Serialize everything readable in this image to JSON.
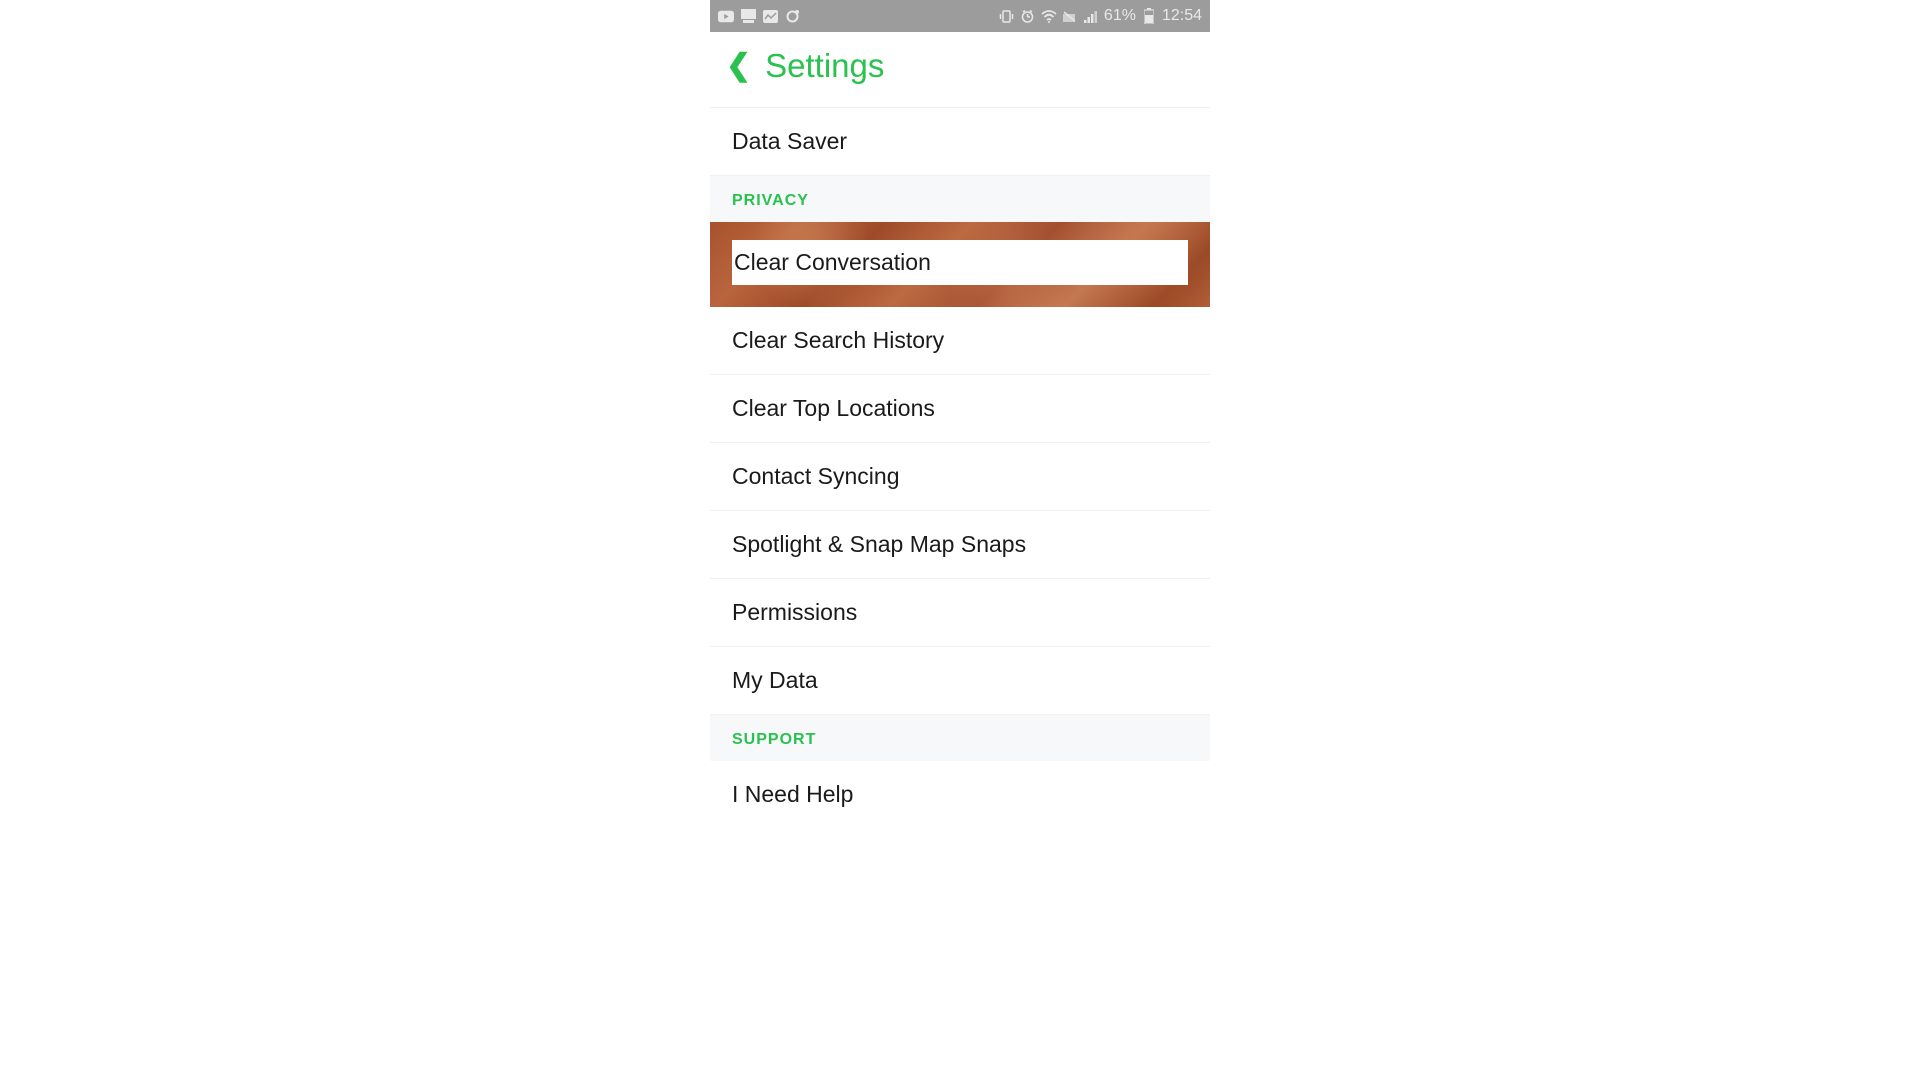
{
  "statusBar": {
    "battery": "61%",
    "time": "12:54"
  },
  "header": {
    "title": "Settings"
  },
  "items": {
    "dataSaver": "Data Saver",
    "clearConversation": "Clear Conversation",
    "clearSearchHistory": "Clear Search History",
    "clearTopLocations": "Clear Top Locations",
    "contactSyncing": "Contact Syncing",
    "spotlightSnaps": "Spotlight & Snap Map Snaps",
    "permissions": "Permissions",
    "myData": "My Data",
    "iNeedHelp": "I Need Help"
  },
  "sections": {
    "privacy": "PRIVACY",
    "support": "SUPPORT"
  }
}
